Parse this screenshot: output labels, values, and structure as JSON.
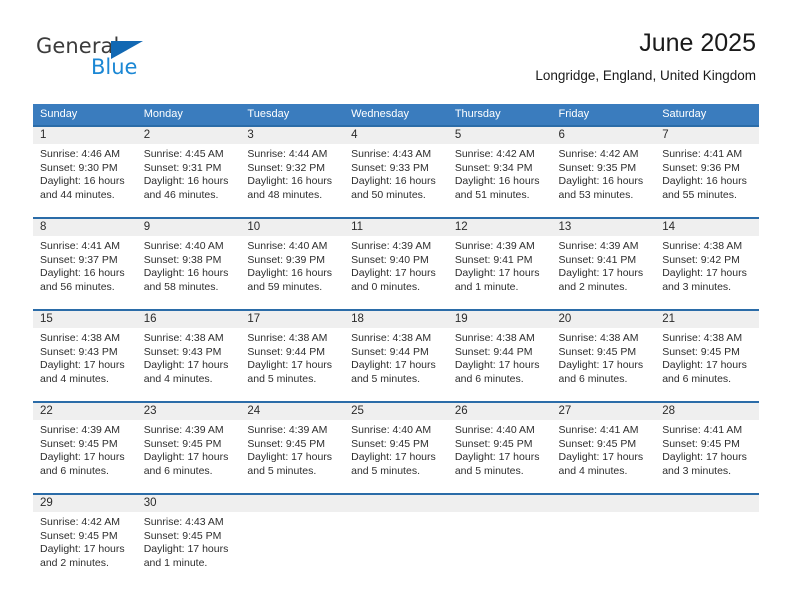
{
  "brand": {
    "name_top": "General",
    "name_bottom": "Blue",
    "triangle_color": "#1268b3",
    "blue_color": "#1b87d4"
  },
  "header": {
    "title": "June 2025",
    "location": "Longridge, England, United Kingdom"
  },
  "theme": {
    "header_blue": "#3a7cbe",
    "row_border_blue": "#2b6ca8",
    "daynum_band": "#efefef"
  },
  "weekday_headers": [
    "Sunday",
    "Monday",
    "Tuesday",
    "Wednesday",
    "Thursday",
    "Friday",
    "Saturday"
  ],
  "weeks": [
    [
      {
        "day": "1",
        "sunrise": "Sunrise: 4:46 AM",
        "sunset": "Sunset: 9:30 PM",
        "daylight_1": "Daylight: 16 hours",
        "daylight_2": "and 44 minutes."
      },
      {
        "day": "2",
        "sunrise": "Sunrise: 4:45 AM",
        "sunset": "Sunset: 9:31 PM",
        "daylight_1": "Daylight: 16 hours",
        "daylight_2": "and 46 minutes."
      },
      {
        "day": "3",
        "sunrise": "Sunrise: 4:44 AM",
        "sunset": "Sunset: 9:32 PM",
        "daylight_1": "Daylight: 16 hours",
        "daylight_2": "and 48 minutes."
      },
      {
        "day": "4",
        "sunrise": "Sunrise: 4:43 AM",
        "sunset": "Sunset: 9:33 PM",
        "daylight_1": "Daylight: 16 hours",
        "daylight_2": "and 50 minutes."
      },
      {
        "day": "5",
        "sunrise": "Sunrise: 4:42 AM",
        "sunset": "Sunset: 9:34 PM",
        "daylight_1": "Daylight: 16 hours",
        "daylight_2": "and 51 minutes."
      },
      {
        "day": "6",
        "sunrise": "Sunrise: 4:42 AM",
        "sunset": "Sunset: 9:35 PM",
        "daylight_1": "Daylight: 16 hours",
        "daylight_2": "and 53 minutes."
      },
      {
        "day": "7",
        "sunrise": "Sunrise: 4:41 AM",
        "sunset": "Sunset: 9:36 PM",
        "daylight_1": "Daylight: 16 hours",
        "daylight_2": "and 55 minutes."
      }
    ],
    [
      {
        "day": "8",
        "sunrise": "Sunrise: 4:41 AM",
        "sunset": "Sunset: 9:37 PM",
        "daylight_1": "Daylight: 16 hours",
        "daylight_2": "and 56 minutes."
      },
      {
        "day": "9",
        "sunrise": "Sunrise: 4:40 AM",
        "sunset": "Sunset: 9:38 PM",
        "daylight_1": "Daylight: 16 hours",
        "daylight_2": "and 58 minutes."
      },
      {
        "day": "10",
        "sunrise": "Sunrise: 4:40 AM",
        "sunset": "Sunset: 9:39 PM",
        "daylight_1": "Daylight: 16 hours",
        "daylight_2": "and 59 minutes."
      },
      {
        "day": "11",
        "sunrise": "Sunrise: 4:39 AM",
        "sunset": "Sunset: 9:40 PM",
        "daylight_1": "Daylight: 17 hours",
        "daylight_2": "and 0 minutes."
      },
      {
        "day": "12",
        "sunrise": "Sunrise: 4:39 AM",
        "sunset": "Sunset: 9:41 PM",
        "daylight_1": "Daylight: 17 hours",
        "daylight_2": "and 1 minute."
      },
      {
        "day": "13",
        "sunrise": "Sunrise: 4:39 AM",
        "sunset": "Sunset: 9:41 PM",
        "daylight_1": "Daylight: 17 hours",
        "daylight_2": "and 2 minutes."
      },
      {
        "day": "14",
        "sunrise": "Sunrise: 4:38 AM",
        "sunset": "Sunset: 9:42 PM",
        "daylight_1": "Daylight: 17 hours",
        "daylight_2": "and 3 minutes."
      }
    ],
    [
      {
        "day": "15",
        "sunrise": "Sunrise: 4:38 AM",
        "sunset": "Sunset: 9:43 PM",
        "daylight_1": "Daylight: 17 hours",
        "daylight_2": "and 4 minutes."
      },
      {
        "day": "16",
        "sunrise": "Sunrise: 4:38 AM",
        "sunset": "Sunset: 9:43 PM",
        "daylight_1": "Daylight: 17 hours",
        "daylight_2": "and 4 minutes."
      },
      {
        "day": "17",
        "sunrise": "Sunrise: 4:38 AM",
        "sunset": "Sunset: 9:44 PM",
        "daylight_1": "Daylight: 17 hours",
        "daylight_2": "and 5 minutes."
      },
      {
        "day": "18",
        "sunrise": "Sunrise: 4:38 AM",
        "sunset": "Sunset: 9:44 PM",
        "daylight_1": "Daylight: 17 hours",
        "daylight_2": "and 5 minutes."
      },
      {
        "day": "19",
        "sunrise": "Sunrise: 4:38 AM",
        "sunset": "Sunset: 9:44 PM",
        "daylight_1": "Daylight: 17 hours",
        "daylight_2": "and 6 minutes."
      },
      {
        "day": "20",
        "sunrise": "Sunrise: 4:38 AM",
        "sunset": "Sunset: 9:45 PM",
        "daylight_1": "Daylight: 17 hours",
        "daylight_2": "and 6 minutes."
      },
      {
        "day": "21",
        "sunrise": "Sunrise: 4:38 AM",
        "sunset": "Sunset: 9:45 PM",
        "daylight_1": "Daylight: 17 hours",
        "daylight_2": "and 6 minutes."
      }
    ],
    [
      {
        "day": "22",
        "sunrise": "Sunrise: 4:39 AM",
        "sunset": "Sunset: 9:45 PM",
        "daylight_1": "Daylight: 17 hours",
        "daylight_2": "and 6 minutes."
      },
      {
        "day": "23",
        "sunrise": "Sunrise: 4:39 AM",
        "sunset": "Sunset: 9:45 PM",
        "daylight_1": "Daylight: 17 hours",
        "daylight_2": "and 6 minutes."
      },
      {
        "day": "24",
        "sunrise": "Sunrise: 4:39 AM",
        "sunset": "Sunset: 9:45 PM",
        "daylight_1": "Daylight: 17 hours",
        "daylight_2": "and 5 minutes."
      },
      {
        "day": "25",
        "sunrise": "Sunrise: 4:40 AM",
        "sunset": "Sunset: 9:45 PM",
        "daylight_1": "Daylight: 17 hours",
        "daylight_2": "and 5 minutes."
      },
      {
        "day": "26",
        "sunrise": "Sunrise: 4:40 AM",
        "sunset": "Sunset: 9:45 PM",
        "daylight_1": "Daylight: 17 hours",
        "daylight_2": "and 5 minutes."
      },
      {
        "day": "27",
        "sunrise": "Sunrise: 4:41 AM",
        "sunset": "Sunset: 9:45 PM",
        "daylight_1": "Daylight: 17 hours",
        "daylight_2": "and 4 minutes."
      },
      {
        "day": "28",
        "sunrise": "Sunrise: 4:41 AM",
        "sunset": "Sunset: 9:45 PM",
        "daylight_1": "Daylight: 17 hours",
        "daylight_2": "and 3 minutes."
      }
    ],
    [
      {
        "day": "29",
        "sunrise": "Sunrise: 4:42 AM",
        "sunset": "Sunset: 9:45 PM",
        "daylight_1": "Daylight: 17 hours",
        "daylight_2": "and 2 minutes."
      },
      {
        "day": "30",
        "sunrise": "Sunrise: 4:43 AM",
        "sunset": "Sunset: 9:45 PM",
        "daylight_1": "Daylight: 17 hours",
        "daylight_2": "and 1 minute."
      },
      {
        "day": "",
        "sunrise": "",
        "sunset": "",
        "daylight_1": "",
        "daylight_2": ""
      },
      {
        "day": "",
        "sunrise": "",
        "sunset": "",
        "daylight_1": "",
        "daylight_2": ""
      },
      {
        "day": "",
        "sunrise": "",
        "sunset": "",
        "daylight_1": "",
        "daylight_2": ""
      },
      {
        "day": "",
        "sunrise": "",
        "sunset": "",
        "daylight_1": "",
        "daylight_2": ""
      },
      {
        "day": "",
        "sunrise": "",
        "sunset": "",
        "daylight_1": "",
        "daylight_2": ""
      }
    ]
  ]
}
